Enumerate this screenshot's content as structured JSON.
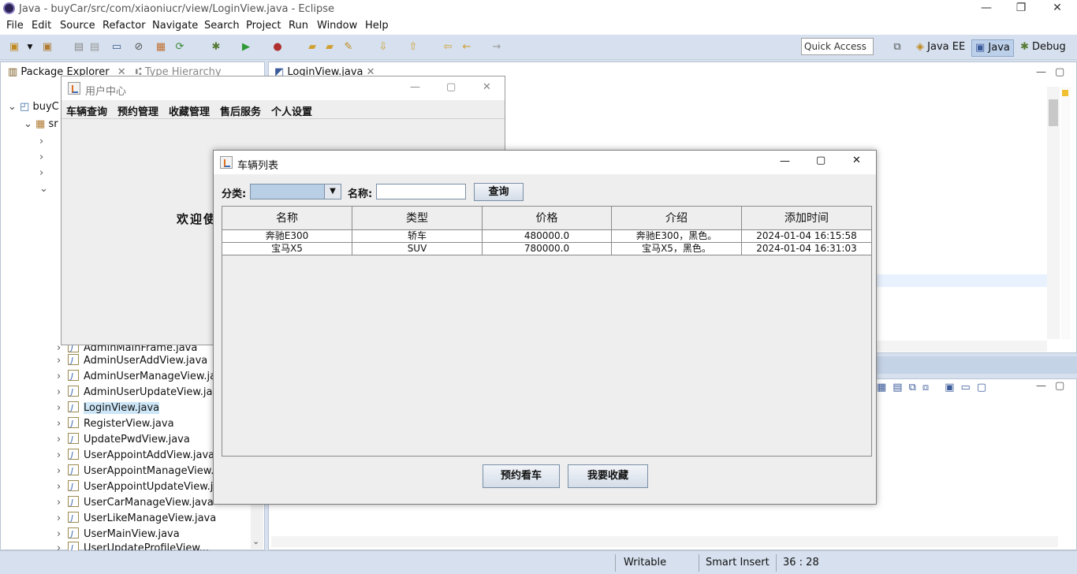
{
  "app": {
    "title": "Java - buyCar/src/com/xiaoniucr/view/LoginView.java - Eclipse",
    "window_controls": {
      "minimize": "—",
      "restore": "❐",
      "close": "✕"
    }
  },
  "menu": [
    "File",
    "Edit",
    "Source",
    "Refactor",
    "Navigate",
    "Search",
    "Project",
    "Run",
    "Window",
    "Help"
  ],
  "toolbar": {
    "quick_access": "Quick Access",
    "perspectives": [
      "Java EE",
      "Java",
      "Debug"
    ]
  },
  "package_explorer": {
    "tab_label": "Package Explorer",
    "tab2_label": "Type Hierarchy",
    "project": "buyC",
    "src": "sr",
    "files": [
      "AdminMainFrame.java",
      "AdminUserAddView.java",
      "AdminUserManageView.java",
      "AdminUserUpdateView.java",
      "LoginView.java",
      "RegisterView.java",
      "UpdatePwdView.java",
      "UserAppointAddView.java",
      "UserAppointManageView.java",
      "UserAppointUpdateView.java",
      "UserCarManageView.java",
      "UserLikeManageView.java",
      "UserMainView.java",
      "UserUpdateProfileView..."
    ],
    "selected": "LoginView.java"
  },
  "editor": {
    "tab_label": "LoginView.java"
  },
  "status": {
    "writable": "Writable",
    "insert": "Smart Insert",
    "position": "36 : 28"
  },
  "user_center": {
    "title": "用户中心",
    "menu": [
      "车辆查询",
      "预约管理",
      "收藏管理",
      "售后服务",
      "个人设置"
    ],
    "welcome": "欢迎使"
  },
  "car_list": {
    "title": "车辆列表",
    "category_label": "分类:",
    "category_value": "",
    "name_label": "名称:",
    "name_value": "",
    "query_button": "查询",
    "columns": [
      "名称",
      "类型",
      "价格",
      "介绍",
      "添加时间"
    ],
    "rows": [
      [
        "奔驰E300",
        "轿车",
        "480000.0",
        "奔驰E300，黑色。",
        "2024-01-04 16:15:58"
      ],
      [
        "宝马X5",
        "SUV",
        "780000.0",
        "宝马X5，黑色。",
        "2024-01-04 16:31:03"
      ]
    ],
    "appoint_button": "预约看车",
    "like_button": "我要收藏"
  }
}
